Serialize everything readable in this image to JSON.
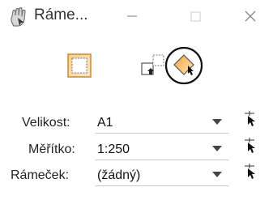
{
  "window": {
    "title": "Ráme...",
    "app_icon": "hand-icon",
    "controls": [
      "minimize-icon",
      "maximize-icon",
      "close-icon"
    ]
  },
  "toolbar": {
    "buttons": [
      {
        "icon": "frame-tool-icon",
        "active": false
      },
      {
        "icon": "place-frame-icon",
        "active": false
      },
      {
        "icon": "diamond-frame-icon",
        "active": true
      }
    ]
  },
  "form": {
    "size": {
      "label": "Velikost:",
      "value": "A1"
    },
    "scale": {
      "label": "Měřítko:",
      "value": "1:250"
    },
    "frame": {
      "label": "Rámeček:",
      "value": "(žádný)"
    }
  },
  "colors": {
    "accent": "#f2a23a",
    "text": "#222222"
  }
}
